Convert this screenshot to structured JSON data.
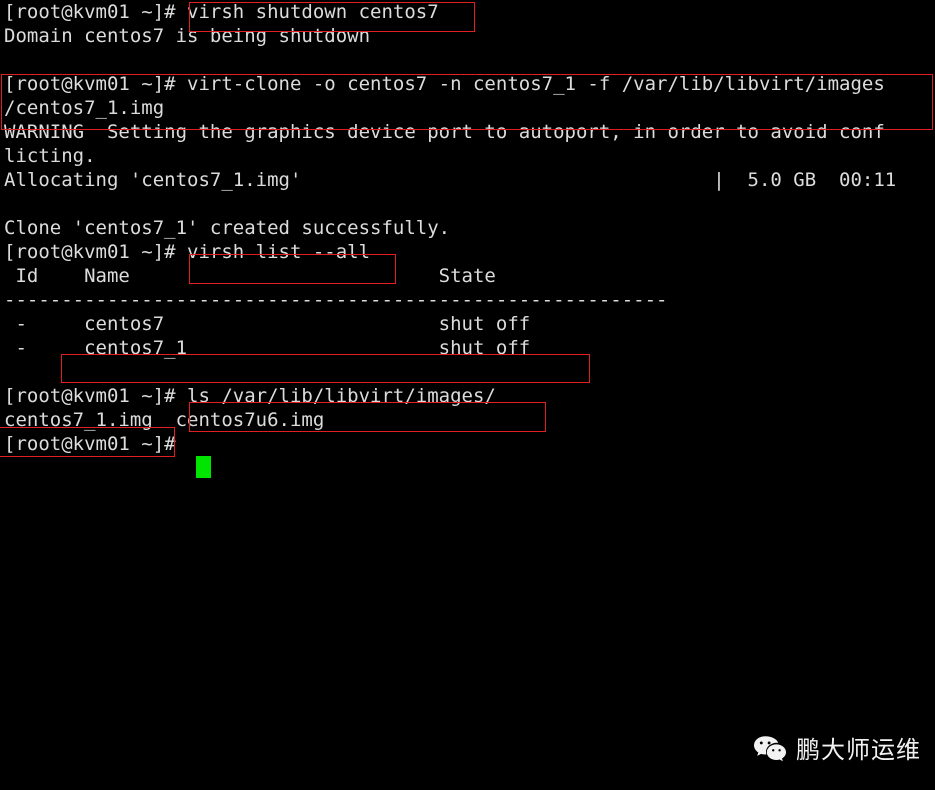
{
  "terminal": {
    "prompt": "[root@kvm01 ~]#",
    "char_width": 11.23,
    "line_height": 24,
    "background": "#000000",
    "foreground": "#dcdcdc",
    "cursor_color": "#00e500",
    "annotation_color": "#e02020",
    "lines": [
      {
        "id": "l1",
        "text": "[root@kvm01 ~]# virsh shutdown centos7"
      },
      {
        "id": "l2",
        "text": "Domain centos7 is being shutdown"
      },
      {
        "id": "l3",
        "text": ""
      },
      {
        "id": "l4",
        "text": "[root@kvm01 ~]# virt-clone -o centos7 -n centos7_1 -f /var/lib/libvirt/images"
      },
      {
        "id": "l5",
        "text": "/centos7_1.img"
      },
      {
        "id": "l6",
        "text": "WARNING  Setting the graphics device port to autoport, in order to avoid conf"
      },
      {
        "id": "l7",
        "text": "licting."
      },
      {
        "id": "l8",
        "text": "Allocating 'centos7_1.img'                                    |  5.0 GB  00:11"
      },
      {
        "id": "l9",
        "text": ""
      },
      {
        "id": "l10",
        "text": "Clone 'centos7_1' created successfully."
      },
      {
        "id": "l11",
        "text": "[root@kvm01 ~]# virsh list --all"
      },
      {
        "id": "l12",
        "text": " Id    Name                           State"
      },
      {
        "id": "l13",
        "text": "----------------------------------------------------------"
      },
      {
        "id": "l14",
        "text": " -     centos7                        shut off"
      },
      {
        "id": "l15",
        "text": " -     centos7_1                      shut off"
      },
      {
        "id": "l16",
        "text": ""
      },
      {
        "id": "l17",
        "text": "[root@kvm01 ~]# ls /var/lib/libvirt/images/"
      },
      {
        "id": "l18",
        "text": "centos7_1.img  centos7u6.img"
      },
      {
        "id": "l19",
        "text": "[root@kvm01 ~]# "
      }
    ],
    "commands": [
      {
        "name": "shutdown-command",
        "text": "virsh shutdown centos7"
      },
      {
        "name": "virt-clone-command",
        "text": "virt-clone -o centos7 -n centos7_1 -f /var/lib/libvirt/images/centos7_1.img"
      },
      {
        "name": "virsh-list-command",
        "text": "virsh list --all"
      },
      {
        "name": "ls-command",
        "text": "ls /var/lib/libvirt/images/"
      }
    ],
    "output_messages": [
      {
        "name": "shutdown-message",
        "text": "Domain centos7 is being shutdown"
      },
      {
        "name": "warning-message",
        "text": "WARNING  Setting the graphics device port to autoport, in order to avoid conflicting."
      },
      {
        "name": "allocating-message",
        "text": "Allocating 'centos7_1.img'"
      },
      {
        "name": "allocating-progress",
        "text": "|  5.0 GB  00:11"
      },
      {
        "name": "clone-success-message",
        "text": "Clone 'centos7_1' created successfully."
      }
    ],
    "vm_table": {
      "headers": [
        "Id",
        "Name",
        "State"
      ],
      "rows": [
        {
          "id": "-",
          "name": "centos7",
          "state": "shut off"
        },
        {
          "id": "-",
          "name": "centos7_1",
          "state": "shut off"
        }
      ]
    },
    "files": [
      "centos7_1.img",
      "centos7u6.img"
    ],
    "progress": {
      "size": "5.0 GB",
      "time": "00:11"
    }
  },
  "watermark": {
    "icon": "wechat-icon",
    "text": "鹏大师运维"
  }
}
